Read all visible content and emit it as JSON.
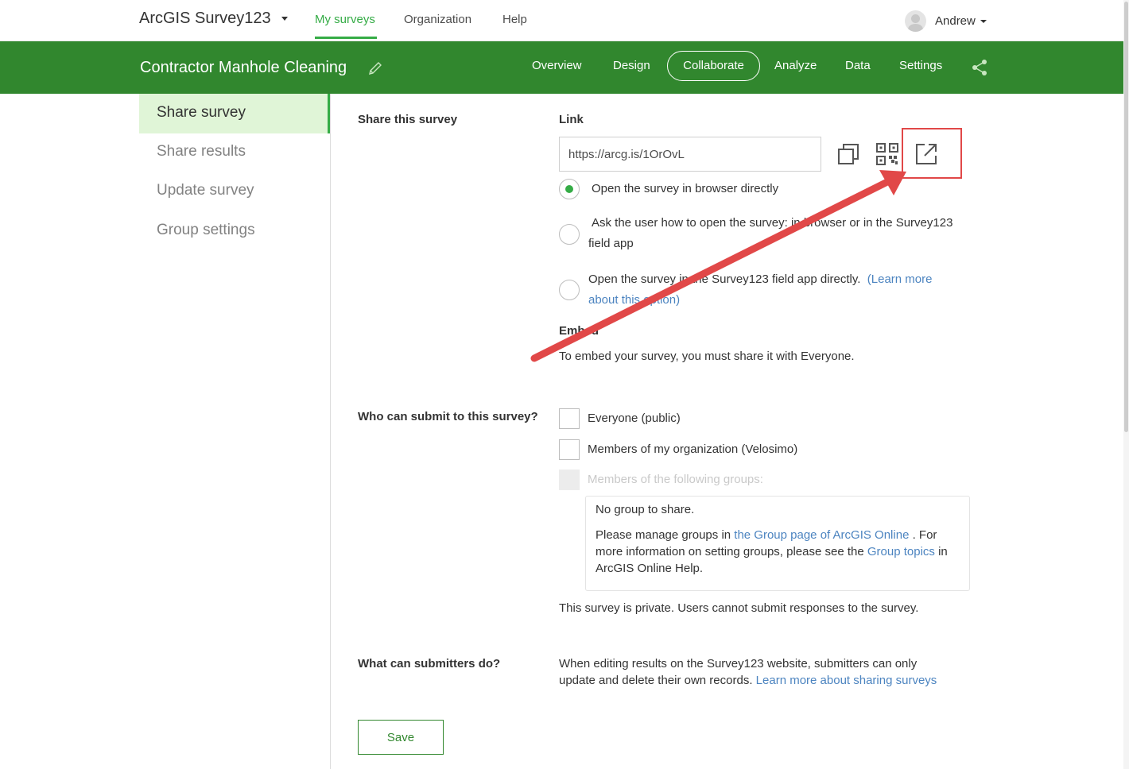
{
  "topnav": {
    "brand": "ArcGIS Survey123",
    "links": [
      "My surveys",
      "Organization",
      "Help"
    ],
    "user": "Andrew"
  },
  "survey": {
    "title": "Contractor Manhole Cleaning",
    "tabs": [
      "Overview",
      "Design",
      "Collaborate",
      "Analyze",
      "Data",
      "Settings"
    ],
    "active_tab": "Collaborate"
  },
  "sidebar": {
    "items": [
      {
        "label": "Share survey",
        "active": true
      },
      {
        "label": "Share results",
        "active": false
      },
      {
        "label": "Update survey",
        "active": false
      },
      {
        "label": "Group settings",
        "active": false
      }
    ]
  },
  "share": {
    "section_label": "Share this survey",
    "link_title": "Link",
    "link_value": "https://arcg.is/1OrOvL",
    "open_options": [
      {
        "text": "Open the survey in browser directly",
        "checked": true
      },
      {
        "text_line1": "Ask the user how to open the survey: in browser or in the Survey123",
        "text_line2": "field app",
        "checked": false
      },
      {
        "text_line1": "Open the survey in the Survey123 field app directly.",
        "link_line1": "(Learn more",
        "link_line2": "about this option)",
        "checked": false
      }
    ],
    "embed_title": "Embed",
    "embed_text": "To embed your survey, you must share it with Everyone."
  },
  "submit": {
    "label": "Who can submit to this survey?",
    "options": [
      {
        "text": "Everyone (public)",
        "disabled": false
      },
      {
        "text": "Members of my organization (Velosimo)",
        "disabled": false
      },
      {
        "text": "Members of the following groups:",
        "disabled": true
      }
    ],
    "groups": {
      "none": "No group to share.",
      "manage_pre": "Please manage groups in ",
      "manage_link": "the Group page of ArcGIS Online",
      "manage_post": " . For",
      "more_pre": "more information on setting groups, please see the ",
      "more_link": "Group topics",
      "more_post": " in",
      "help": "ArcGIS Online Help."
    },
    "private_notice": "This survey is private. Users cannot submit responses to the survey."
  },
  "submitters": {
    "label": "What can submitters do?",
    "line1": "When editing results on the Survey123 website, submitters can only",
    "line2_pre": "update and delete their own records. ",
    "line2_link": "Learn more about sharing surveys"
  },
  "save_label": "Save",
  "colors": {
    "brand_green": "#31872e",
    "accent_green": "#35ac46",
    "link_blue": "#4c84c0",
    "annotation_red": "#e14848"
  }
}
